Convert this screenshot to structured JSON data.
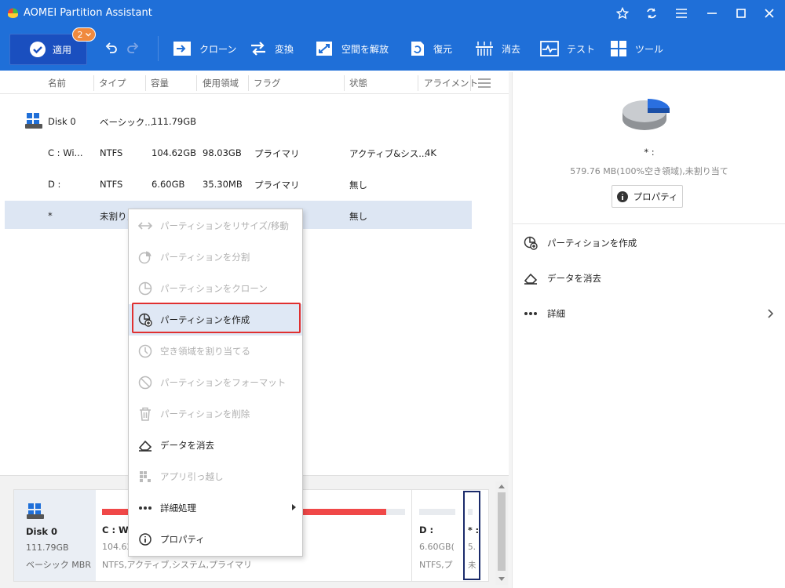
{
  "window": {
    "title": "AOMEI Partition Assistant"
  },
  "toolbar": {
    "apply_label": "適用",
    "pending_count": "2",
    "buttons": [
      {
        "label": "クローン",
        "icon": "clone-icon"
      },
      {
        "label": "変換",
        "icon": "convert-icon"
      },
      {
        "label": "空間を解放",
        "icon": "free-space-icon"
      },
      {
        "label": "復元",
        "icon": "restore-icon"
      },
      {
        "label": "消去",
        "icon": "wipe-icon"
      },
      {
        "label": "テスト",
        "icon": "test-icon"
      },
      {
        "label": "ツール",
        "icon": "tools-icon"
      }
    ]
  },
  "columns": [
    "名前",
    "タイプ",
    "容量",
    "使用領域",
    "フラグ",
    "状態",
    "アライメント"
  ],
  "rows": [
    {
      "name": "Disk 0",
      "type": "ベーシック...",
      "capacity": "111.79GB",
      "used": "",
      "flag": "",
      "status": "",
      "align": ""
    },
    {
      "name": "C : Wi...",
      "type": "NTFS",
      "capacity": "104.62GB",
      "used": "98.03GB",
      "flag": "プライマリ",
      "status": "アクティブ&シス...",
      "align": "4K"
    },
    {
      "name": "D :",
      "type": "NTFS",
      "capacity": "6.60GB",
      "used": "35.30MB",
      "flag": "プライマリ",
      "status": "無し",
      "align": ""
    },
    {
      "name": "*",
      "type": "未割り当",
      "capacity": "",
      "used": "",
      "flag": "",
      "status": "無し",
      "align": ""
    }
  ],
  "context_menu": [
    {
      "label": "パーティションをリサイズ/移動",
      "icon": "resize-icon",
      "enabled": false
    },
    {
      "label": "パーティションを分割",
      "icon": "split-icon",
      "enabled": false
    },
    {
      "label": "パーティションをクローン",
      "icon": "clone-partition-icon",
      "enabled": false
    },
    {
      "label": "パーティションを作成",
      "icon": "create-partition-icon",
      "enabled": true
    },
    {
      "label": "空き領域を割り当てる",
      "icon": "allocate-icon",
      "enabled": false
    },
    {
      "label": "パーティションをフォーマット",
      "icon": "format-icon",
      "enabled": false
    },
    {
      "label": "パーティションを削除",
      "icon": "trash-icon",
      "enabled": false
    },
    {
      "label": "データを消去",
      "icon": "eraser-icon",
      "enabled": true
    },
    {
      "label": "アプリ引っ越し",
      "icon": "app-move-icon",
      "enabled": false
    },
    {
      "label": "詳細処理",
      "icon": "more-icon",
      "enabled": true
    },
    {
      "label": "プロパティ",
      "icon": "info-icon",
      "enabled": true
    }
  ],
  "right_panel": {
    "name": "* :",
    "desc": "579.76 MB(100%空き領域),未割り当て",
    "properties_button": "プロパティ",
    "actions": [
      "パーティションを作成",
      "データを消去",
      "詳細"
    ]
  },
  "disk_map": {
    "disk_name": "Disk 0",
    "disk_size": "111.79GB",
    "disk_type": "ベーシック MBR",
    "c_label": "C : Wi",
    "c_size": "104.62",
    "c_desc": "NTFS,アクティブ,システム,プライマリ",
    "c_usage": 0.937,
    "d_label": "D :",
    "d_size": "6.60GB(",
    "d_desc": "NTFS,プ",
    "u_label": "* :",
    "u_size": "5.",
    "u_desc": "未"
  },
  "colors": {
    "accent": "#1f6fd8",
    "highlight_border": "#e03030",
    "selected_row": "#dde6f3",
    "usage_bar": "#f04848"
  }
}
